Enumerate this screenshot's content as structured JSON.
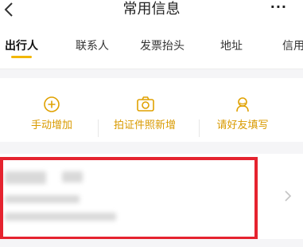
{
  "nav": {
    "title": "常用信息",
    "more": "···",
    "back_icon": "chevron-left-icon"
  },
  "tabs": [
    {
      "label": "出行人",
      "active": true
    },
    {
      "label": "联系人",
      "active": false
    },
    {
      "label": "发票抬头",
      "active": false
    },
    {
      "label": "地址",
      "active": false
    },
    {
      "label": "信用",
      "active": false
    }
  ],
  "actions": [
    {
      "label": "手动增加",
      "icon": "plus-circle-icon"
    },
    {
      "label": "拍证件照新增",
      "icon": "camera-icon"
    },
    {
      "label": "请好友填写",
      "icon": "friend-icon"
    }
  ],
  "colors": {
    "accent": "#f2b705",
    "action_text": "#d99a00",
    "highlight": "#e5232f"
  }
}
